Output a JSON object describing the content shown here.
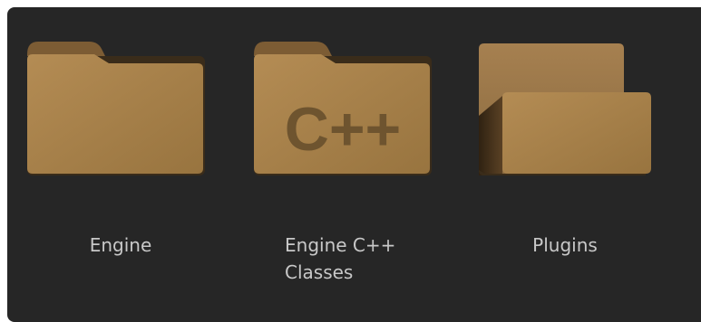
{
  "content_browser": {
    "items": [
      {
        "icon": "folder-icon",
        "label": "Engine"
      },
      {
        "icon": "cpp-folder-icon",
        "badge": "C++",
        "label_line1": "Engine C++",
        "label_line2": "Classes"
      },
      {
        "icon": "open-folder-icon",
        "label": "Plugins"
      }
    ]
  },
  "colors": {
    "panel_background": "#262626",
    "folder_light": "#b48c54",
    "folder_mid": "#9a7544",
    "folder_dark": "#5a4124",
    "badge_text": "#6e542f",
    "label_text": "#c8c8c8"
  }
}
